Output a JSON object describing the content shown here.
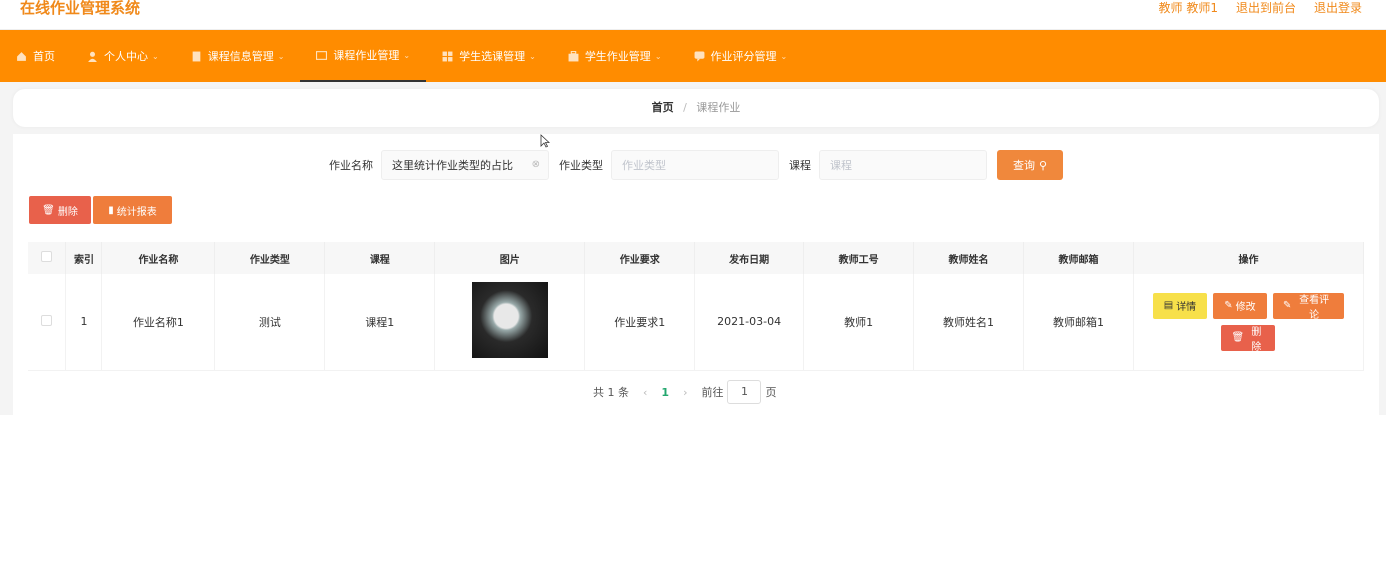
{
  "app": {
    "title": "在线作业管理系统"
  },
  "top_right": {
    "user": "教师 教师1",
    "to_front": "退出到前台",
    "logout": "退出登录"
  },
  "nav": [
    {
      "label": "首页",
      "icon": "home-icon"
    },
    {
      "label": "个人中心",
      "icon": "user-icon"
    },
    {
      "label": "课程信息管理",
      "icon": "book-icon"
    },
    {
      "label": "课程作业管理",
      "icon": "file-icon",
      "active": true
    },
    {
      "label": "学生选课管理",
      "icon": "grid-icon"
    },
    {
      "label": "学生作业管理",
      "icon": "briefcase-icon"
    },
    {
      "label": "作业评分管理",
      "icon": "chat-icon"
    }
  ],
  "breadcrumb": {
    "home": "首页",
    "sep": "/",
    "current": "课程作业"
  },
  "search": {
    "name_label": "作业名称",
    "name_value": "这里统计作业类型的占比",
    "type_label": "作业类型",
    "type_placeholder": "作业类型",
    "course_label": "课程",
    "course_placeholder": "课程",
    "button": "查询"
  },
  "actions": {
    "delete": "删除",
    "stats": "统计报表"
  },
  "table": {
    "headers": [
      "索引",
      "作业名称",
      "作业类型",
      "课程",
      "图片",
      "作业要求",
      "发布日期",
      "教师工号",
      "教师姓名",
      "教师邮箱",
      "操作"
    ],
    "rows": [
      {
        "index": "1",
        "name": "作业名称1",
        "type": "测试",
        "course": "课程1",
        "requirement": "作业要求1",
        "date": "2021-03-04",
        "teacher_id": "教师1",
        "teacher_name": "教师姓名1",
        "teacher_email": "教师邮箱1"
      }
    ],
    "row_actions": {
      "detail": "详情",
      "edit": "修改",
      "review": "查看评论",
      "delete": "删除"
    }
  },
  "pagination": {
    "total": "共 1 条",
    "prev": "‹",
    "current": "1",
    "next": "›",
    "goto_prefix": "前往",
    "goto_value": "1",
    "goto_suffix": "页"
  }
}
